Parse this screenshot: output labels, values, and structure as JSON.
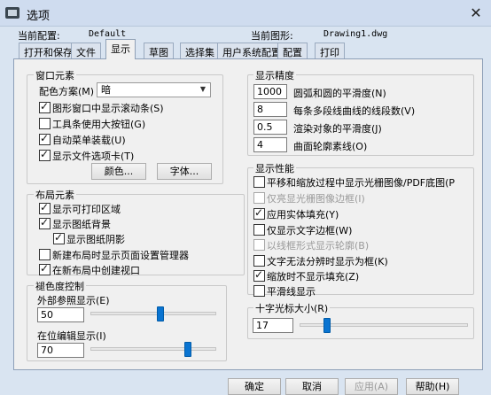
{
  "window": {
    "title": "选项",
    "close_glyph": "✕"
  },
  "info": {
    "current_profile_label": "当前配置:",
    "current_profile_value": "Default",
    "current_drawing_label": "当前图形:",
    "current_drawing_value": "Drawing1.dwg"
  },
  "tabs": [
    {
      "label": "打开和保存",
      "active": false
    },
    {
      "label": "文件",
      "active": false
    },
    {
      "label": "显示",
      "active": true
    },
    {
      "label": "草图",
      "active": false
    },
    {
      "label": "选择集",
      "active": false
    },
    {
      "label": "用户系统配置",
      "active": false
    },
    {
      "label": "配置",
      "active": false
    },
    {
      "label": "打印",
      "active": false
    }
  ],
  "window_elements": {
    "title": "窗口元素",
    "color_scheme_label": "配色方案(M)",
    "color_scheme_value": "暗",
    "checkboxes": [
      {
        "label": "图形窗口中显示滚动条(S)",
        "checked": true
      },
      {
        "label": "工具条使用大按钮(G)",
        "checked": false
      },
      {
        "label": "自动菜单装载(U)",
        "checked": true
      },
      {
        "label": "显示文件选项卡(T)",
        "checked": true
      }
    ],
    "colors_button": "颜色...",
    "fonts_button": "字体..."
  },
  "layout_elements": {
    "title": "布局元素",
    "checkboxes": [
      {
        "label": "显示可打印区域",
        "checked": true
      },
      {
        "label": "显示图纸背景",
        "checked": true
      },
      {
        "label": "显示图纸阴影",
        "checked": true
      },
      {
        "label": "新建布局时显示页面设置管理器",
        "checked": false
      },
      {
        "label": "在新布局中创建视口",
        "checked": true
      }
    ]
  },
  "fade_control": {
    "title": "褪色度控制",
    "xref_label": "外部参照显示(E)",
    "xref_value": "50",
    "xref_level": 50,
    "inplace_label": "在位编辑显示(I)",
    "inplace_value": "70",
    "inplace_level": 70
  },
  "display_resolution": {
    "title": "显示精度",
    "rows": [
      {
        "value": "1000",
        "label": "圆弧和圆的平滑度(N)"
      },
      {
        "value": "8",
        "label": "每条多段线曲线的线段数(V)"
      },
      {
        "value": "0.5",
        "label": "渲染对象的平滑度(J)"
      },
      {
        "value": "4",
        "label": "曲面轮廓素线(O)"
      }
    ]
  },
  "display_performance": {
    "title": "显示性能",
    "checkboxes": [
      {
        "label": "平移和缩放过程中显示光栅图像/PDF底图(P",
        "checked": false,
        "disabled": false
      },
      {
        "label": "仅亮显光栅图像边框(I)",
        "checked": false,
        "disabled": true
      },
      {
        "label": "应用实体填充(Y)",
        "checked": true,
        "disabled": false
      },
      {
        "label": "仅显示文字边框(W)",
        "checked": false,
        "disabled": false
      },
      {
        "label": "以线框形式显示轮廓(B)",
        "checked": false,
        "disabled": true
      },
      {
        "label": "文字无法分辨时显示为框(K)",
        "checked": false,
        "disabled": false
      },
      {
        "label": "缩放时不显示填充(Z)",
        "checked": true,
        "disabled": false
      },
      {
        "label": "平滑线显示",
        "checked": false,
        "disabled": false
      }
    ]
  },
  "crosshair": {
    "title": "十字光标大小(R)",
    "value": "17",
    "level": 17
  },
  "footer": {
    "ok": "确定",
    "cancel": "取消",
    "apply": "应用(A)",
    "help": "帮助(H)"
  }
}
